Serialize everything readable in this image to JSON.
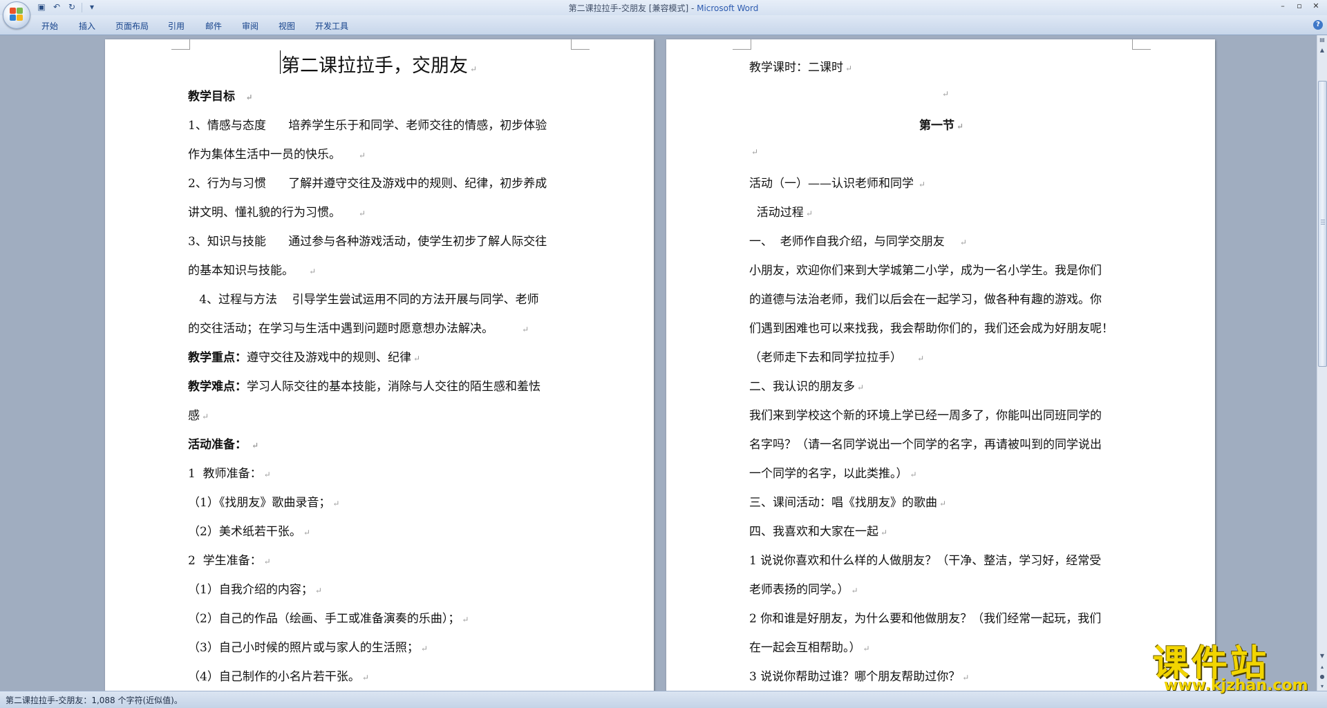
{
  "window": {
    "title_doc": "第二课拉拉手-交朋友 [兼容模式] - ",
    "title_app": "Microsoft Word"
  },
  "quick_access": {
    "icons": [
      "save-icon",
      "undo-icon",
      "redo-icon",
      "customize-icon"
    ]
  },
  "ribbon_tabs": [
    "开始",
    "插入",
    "页面布局",
    "引用",
    "邮件",
    "审阅",
    "视图",
    "开发工具"
  ],
  "left_page": {
    "title": "第二课拉拉手，交朋友",
    "lines": [
      "教学目标",
      "1、情感与态度      培养学生乐于和同学、老师交往的情感，初步体验",
      "作为集体生活中一员的快乐。",
      "2、行为与习惯      了解并遵守交往及游戏中的规则、纪律，初步养成",
      "讲文明、懂礼貌的行为习惯。",
      "3、知识与技能      通过参与各种游戏活动，使学生初步了解人际交往",
      "的基本知识与技能。",
      "   4、过程与方法    引导学生尝试运用不同的方法开展与同学、老师",
      "的交往活动；在学习与生活中遇到问题时愿意想办法解决。",
      "遵守交往及游戏中的规则、纪律",
      "学习人际交往的基本技能，消除与人交往的陌生感和羞怯",
      "感",
      "活动准备：",
      "1  教师准备：",
      "（1）《找朋友》歌曲录音；",
      "（2）美术纸若干张。",
      "2  学生准备：",
      "（1）自我介绍的内容；",
      "（2）自己的作品（绘画、手工或准备演奏的乐曲）；",
      "（3）自己小时候的照片或与家人的生活照；",
      "（4）自己制作的小名片若干张。"
    ],
    "label_key": "教学重点：",
    "label_difficulty": "教学难点："
  },
  "right_page": {
    "lines": [
      "教学课时：二课时",
      "第一节",
      "活动（一）——认识老师和同学",
      "  活动过程",
      "一、  老师作自我介绍，与同学交朋友",
      "小朋友，欢迎你们来到大学城第二小学，成为一名小学生。我是你们",
      "的道德与法治老师，我们以后会在一起学习，做各种有趣的游戏。你",
      "们遇到困难也可以来找我，我会帮助你们的，我们还会成为好朋友呢！",
      "（老师走下去和同学拉拉手）",
      "二、我认识的朋友多",
      "我们来到学校这个新的环境上学已经一周多了，你能叫出同班同学的",
      "名字吗？（请一名同学说出一个同学的名字，再请被叫到的同学说出",
      "一个同学的名字，以此类推。）",
      "三、课间活动：唱《找朋友》的歌曲",
      "四、我喜欢和大家在一起",
      "1 说说你喜欢和什么样的人做朋友？（干净、整洁，学习好，经常受",
      "老师表扬的同学。）",
      "2 你和谁是好朋友，为什么要和他做朋友？（我们经常一起玩，我们",
      "在一起会互相帮助。）",
      "3 说说你帮助过谁？哪个朋友帮助过你？"
    ]
  },
  "status_bar": {
    "text": "第二课拉拉手-交朋友：1,088 个字符(近似值)。"
  },
  "watermark": {
    "top": "课件站",
    "bottom": "www.kjzhan.com"
  },
  "colors": {
    "ribbon_text": "#15428b",
    "watermark": "#f2d500",
    "app_title": "#2d5bb0"
  }
}
